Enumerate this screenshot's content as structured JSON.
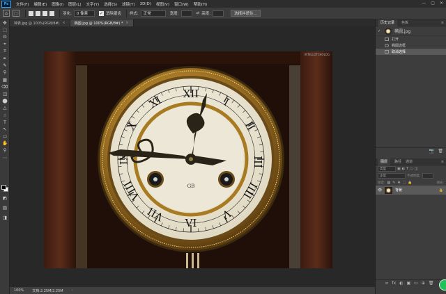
{
  "menubar": {
    "logo": "Ps",
    "items": [
      "文件(F)",
      "编辑(E)",
      "图像(I)",
      "图层(L)",
      "文字(Y)",
      "选择(S)",
      "滤镜(T)",
      "3D(D)",
      "视图(V)",
      "窗口(W)",
      "帮助(H)"
    ],
    "controls": [
      "—",
      "▢",
      "✕"
    ]
  },
  "options": {
    "feather_label": "羽化:",
    "feather_value": "0 像素",
    "antialias_label": "消除锯齿",
    "style_label": "样式:",
    "style_value": "正常",
    "width_label": "宽度:",
    "height_label": "高度:",
    "select_mask_btn": "选择并遮住..."
  },
  "tabs": [
    {
      "label": "钟表.jpg @ 100%(RGB/8#)",
      "close": "×"
    },
    {
      "label": "椭圆.jpg @ 100%(RGB/8#) *",
      "close": "×"
    }
  ],
  "canvas": {
    "watermark": "INTELLOTCHOLOG",
    "clock_numerals": [
      "XII",
      "I",
      "II",
      "III",
      "IIII",
      "V",
      "VI",
      "VII",
      "VIII",
      "IX",
      "X",
      "XI"
    ],
    "dial_monogram": "GB"
  },
  "status": {
    "zoom": "100%",
    "doc": "文档:2.25M/2.25M",
    "arrow": "›"
  },
  "history_panel": {
    "tabs": [
      "历史记录",
      "色板"
    ],
    "snapshot": "椭圆.jpg",
    "items": [
      "打开",
      "椭圆选框",
      "取消选择"
    ],
    "selected_index": 2,
    "footer_icons": [
      "📷",
      "🗑"
    ]
  },
  "layers_panel": {
    "tabs": [
      "图层",
      "路径",
      "通道"
    ],
    "filter_label": "类型",
    "blend_mode": "正常",
    "opacity_label": "不透明度:",
    "lock_label": "锁定:",
    "fill_label": "填充:",
    "layer_name": "背景",
    "lock_icon": "🔒",
    "footer_icons": [
      "∞",
      "fx",
      "◐",
      "▣",
      "▭",
      "⊕",
      "🗑"
    ]
  },
  "tools": [
    "✥",
    "⬚",
    "ʘ",
    "⌖",
    "⌗",
    "✒",
    "✎",
    "⚲",
    "▦",
    "⌫",
    "◫",
    "⬤",
    "△",
    "☝",
    "T",
    "↖",
    "▭",
    "✋",
    "⚲",
    "⋯",
    "◩",
    "▤",
    "◨"
  ],
  "colors": {
    "accent": "#31a8ff",
    "selected_row": "#5a5a5a",
    "canvas_bg": "#282828"
  }
}
